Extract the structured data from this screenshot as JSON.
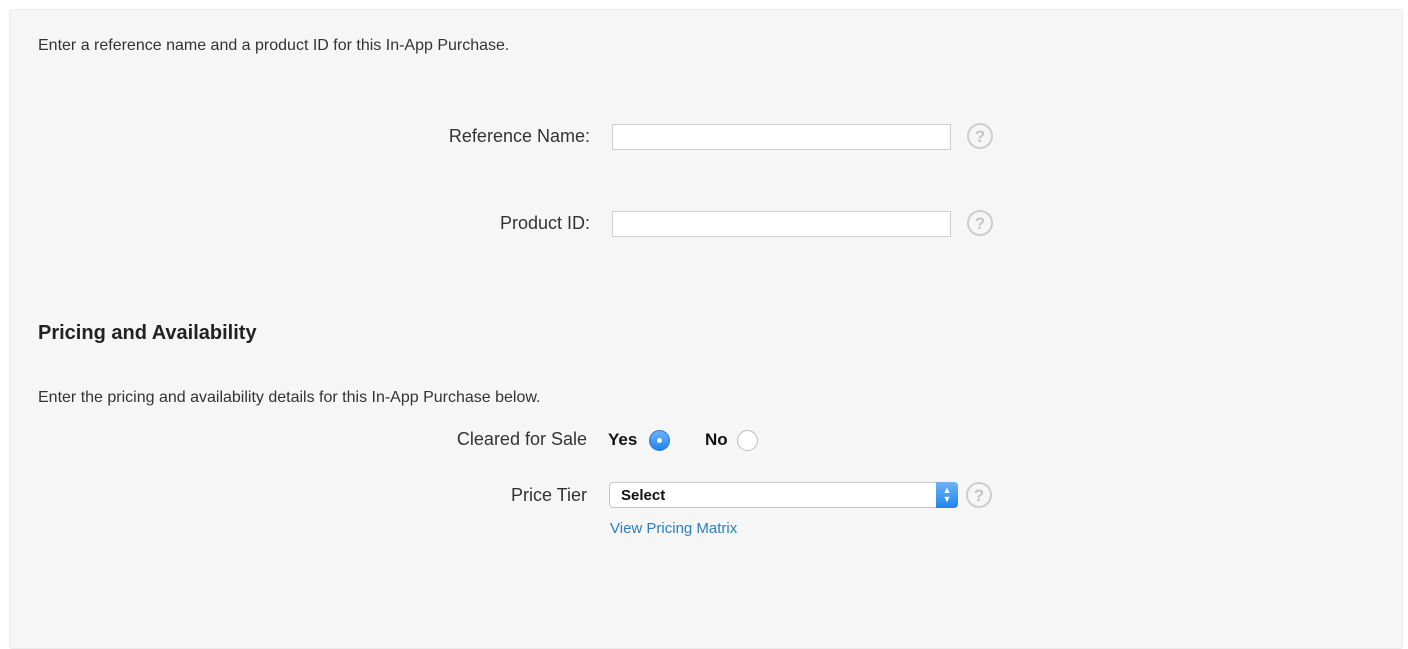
{
  "intro_text": "Enter a reference name and a product ID for this In-App Purchase.",
  "fields": {
    "reference_name": {
      "label": "Reference Name:",
      "value": ""
    },
    "product_id": {
      "label": "Product ID:",
      "value": ""
    }
  },
  "help_glyph": "?",
  "icons": {
    "help": "question-circle-icon",
    "select_arrows": "up-down-chevron-icon"
  },
  "pricing": {
    "title": "Pricing and Availability",
    "description": "Enter the pricing and availability details for this In-App Purchase below.",
    "cleared_for_sale": {
      "label": "Cleared for Sale",
      "yes_label": "Yes",
      "no_label": "No",
      "selected": "Yes"
    },
    "price_tier": {
      "label": "Price Tier",
      "selected": "Select"
    },
    "view_matrix_link": "View Pricing Matrix"
  },
  "colors": {
    "accent": "#1f84ec",
    "link": "#2a7fc0",
    "panel_bg": "#f6f6f6"
  }
}
